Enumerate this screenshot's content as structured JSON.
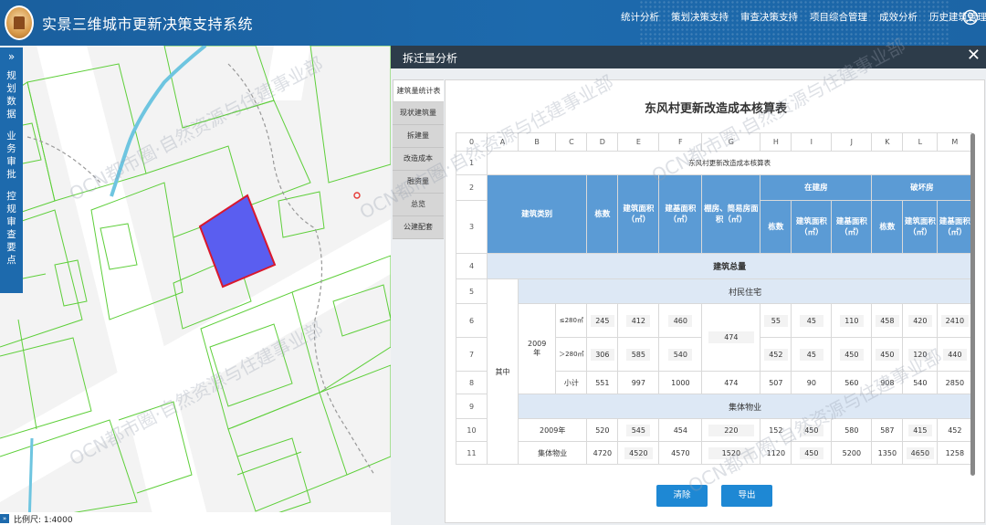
{
  "header": {
    "title": "实景三维城市更新决策支持系统",
    "nav": [
      "统计分析",
      "策划决策支持",
      "审查决策支持",
      "项目综合管理",
      "成效分析",
      "历史建筑管理"
    ]
  },
  "sidebar": {
    "toggle": "»",
    "groups": [
      {
        "label": "规划数据",
        "chars": [
          "规",
          "划",
          "数",
          "据"
        ]
      },
      {
        "label": "业务审批",
        "chars": [
          "业",
          "务",
          "审",
          "批"
        ]
      },
      {
        "label": "控规审查要点",
        "chars": [
          "控",
          "规",
          "审",
          "查",
          "要",
          "点"
        ]
      }
    ]
  },
  "map": {
    "scale_label": "比例尺: 1:4000",
    "watermark": "OCN都市圈·自然资源与住建事业部"
  },
  "panel": {
    "title": "拆迁量分析",
    "tabs": [
      "建筑量统计表",
      "现状建筑量",
      "拆建量",
      "改造成本",
      "融资量",
      "总览",
      "公建配套"
    ],
    "table_title": "东风村更新改造成本核算表",
    "col_letters": [
      "0",
      "A",
      "B",
      "C",
      "D",
      "E",
      "F",
      "G",
      "H",
      "I",
      "J",
      "K",
      "L",
      "M"
    ],
    "row_numbers": [
      "1",
      "2",
      "3",
      "4",
      "5",
      "6",
      "7",
      "8",
      "9",
      "10",
      "11"
    ],
    "row1_title": "东风村更新改造成本核算表",
    "headers": {
      "building_type": "建筑类别",
      "count": "栋数",
      "floor_area": "建筑面积（㎡）",
      "base_area": "建基面积（㎡）",
      "shed_area": "棚房、简易房面积（㎡）",
      "in_construction": "在建房",
      "damaged": "破坏房",
      "count2": "栋数",
      "floor_area2": "建筑面积（㎡）",
      "base_area2": "建基面积（㎡）",
      "count3": "栋数",
      "floor_area3": "建筑面积（㎡）",
      "base_area3": "建基面积（㎡）"
    },
    "section_total": "建筑总量",
    "section_residential": "村民住宅",
    "section_collective": "集体物业",
    "label_qizhong": "其中",
    "label_2009": "2009年",
    "label_le280": "≤280㎡",
    "label_gt280": "＞280㎡",
    "label_subtotal": "小计",
    "label_2009_row": "2009年",
    "label_collective_row": "集体物业",
    "rows": {
      "r6": [
        "245",
        "412",
        "460",
        "474",
        "55",
        "45",
        "110",
        "458",
        "420",
        "2410"
      ],
      "r7": [
        "306",
        "585",
        "540",
        "452",
        "45",
        "450",
        "450",
        "120",
        "440"
      ],
      "r8": [
        "551",
        "997",
        "1000",
        "474",
        "507",
        "90",
        "560",
        "908",
        "540",
        "2850"
      ],
      "r10": [
        "520",
        "545",
        "454",
        "220",
        "152",
        "450",
        "580",
        "587",
        "415",
        "452"
      ],
      "r11": [
        "4720",
        "4520",
        "4570",
        "1520",
        "1120",
        "450",
        "5200",
        "1350",
        "4650",
        "1258"
      ]
    },
    "buttons": {
      "clear": "清除",
      "export": "导出"
    }
  }
}
